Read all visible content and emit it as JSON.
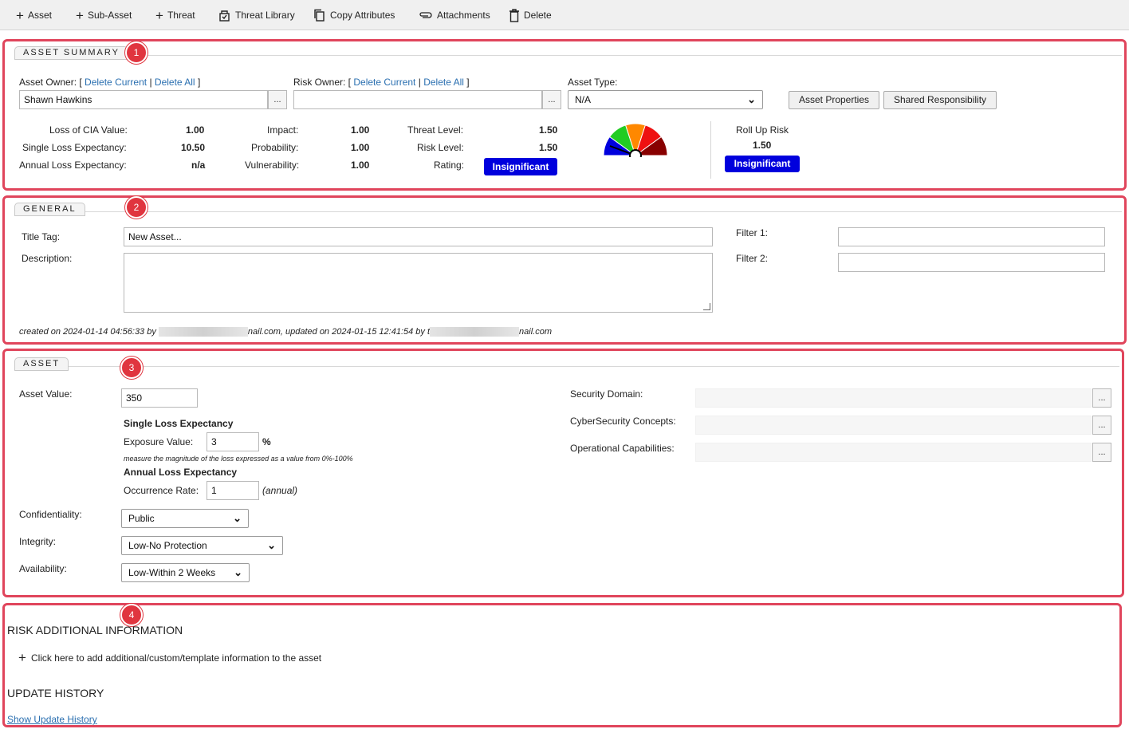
{
  "toolbar": {
    "asset": "Asset",
    "sub_asset": "Sub-Asset",
    "threat": "Threat",
    "threat_library": "Threat Library",
    "copy_attributes": "Copy Attributes",
    "attachments": "Attachments",
    "delete": "Delete"
  },
  "markers": [
    "1",
    "2",
    "3",
    "4"
  ],
  "summary": {
    "legend": "ASSET SUMMARY",
    "asset_owner_label": "Asset Owner: [",
    "delete_current": "Delete Current",
    "sep": "|",
    "delete_all": "Delete All",
    "close_bracket": "]",
    "asset_owner_value": "Shawn Hawkins",
    "risk_owner_label": "Risk Owner: [",
    "risk_owner_value": "",
    "asset_type_label": "Asset Type:",
    "asset_type_value": "N/A",
    "asset_properties": "Asset Properties",
    "shared_responsibility": "Shared Responsibility",
    "dots": "...",
    "loss_cia_label": "Loss of CIA Value:",
    "loss_cia_value": "1.00",
    "sle_label": "Single Loss Expectancy:",
    "sle_value": "10.50",
    "ale_label": "Annual Loss Expectancy:",
    "ale_value": "n/a",
    "impact_label": "Impact:",
    "impact_value": "1.00",
    "probability_label": "Probability:",
    "probability_value": "1.00",
    "vulnerability_label": "Vulnerability:",
    "vulnerability_value": "1.00",
    "threat_level_label": "Threat Level:",
    "threat_level_value": "1.50",
    "risk_level_label": "Risk Level:",
    "risk_level_value": "1.50",
    "rating_label": "Rating:",
    "rating_value": "Insignificant",
    "rollup_label": "Roll Up Risk",
    "rollup_value": "1.50",
    "rollup_rating": "Insignificant",
    "gauge_colors": [
      "#0000dd",
      "#22cc22",
      "#ff8800",
      "#ee1111",
      "#880000"
    ],
    "gauge_icon": "risk-gauge-icon"
  },
  "general": {
    "legend": "GENERAL",
    "title_tag_label": "Title Tag:",
    "title_tag_value": "New Asset...",
    "description_label": "Description:",
    "filter1_label": "Filter 1:",
    "filter2_label": "Filter 2:",
    "meta_created": "created on 2024-01-14 04:56:33 by",
    "meta_created_suffix": "nail.com, updated on 2024-01-15 12:41:54 by",
    "meta_updated_prefix": "t",
    "meta_updated_suffix": "nail.com"
  },
  "asset": {
    "legend": "ASSET",
    "asset_value_label": "Asset Value:",
    "asset_value": "350",
    "sle_heading": "Single Loss Expectancy",
    "exposure_label": "Exposure Value:",
    "exposure_value": "3",
    "percent": "%",
    "exposure_hint": "measure the magnitude of the loss expressed as a value from 0%-100%",
    "ale_heading": "Annual Loss Expectancy",
    "occurrence_label": "Occurrence Rate:",
    "occurrence_value": "1",
    "annual": "(annual)",
    "confidentiality_label": "Confidentiality:",
    "confidentiality_value": "Public",
    "integrity_label": "Integrity:",
    "integrity_value": "Low-No Protection",
    "availability_label": "Availability:",
    "availability_value": "Low-Within 2 Weeks",
    "security_domain_label": "Security Domain:",
    "cyber_concepts_label": "CyberSecurity Concepts:",
    "operational_label": "Operational Capabilities:"
  },
  "additional": {
    "risk_heading": "RISK ADDITIONAL INFORMATION",
    "add_info": "Click here to add additional/custom/template information to the asset",
    "update_heading": "UPDATE HISTORY",
    "show_history": "Show Update History"
  }
}
